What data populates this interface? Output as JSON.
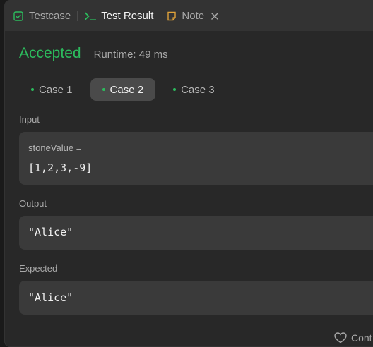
{
  "tabs": [
    {
      "label": "Testcase",
      "icon": "checkbox-icon"
    },
    {
      "label": "Test Result",
      "icon": "terminal-icon"
    },
    {
      "label": "Note",
      "icon": "note-icon"
    }
  ],
  "result": {
    "status": "Accepted",
    "runtime": "Runtime: 49 ms"
  },
  "cases": [
    "Case 1",
    "Case 2",
    "Case 3"
  ],
  "sections": {
    "input_label": "Input",
    "input_var": "stoneValue =",
    "input_value": "[1,2,3,-9]",
    "output_label": "Output",
    "output_value": "\"Alice\"",
    "expected_label": "Expected",
    "expected_value": "\"Alice\""
  },
  "footer": {
    "label": "Cont"
  },
  "colors": {
    "accent_green": "#2cbb5d",
    "panel_bg": "#282828",
    "tabbar_bg": "#333333",
    "box_bg": "#3a3a3a",
    "note_icon": "#e0a33a"
  }
}
